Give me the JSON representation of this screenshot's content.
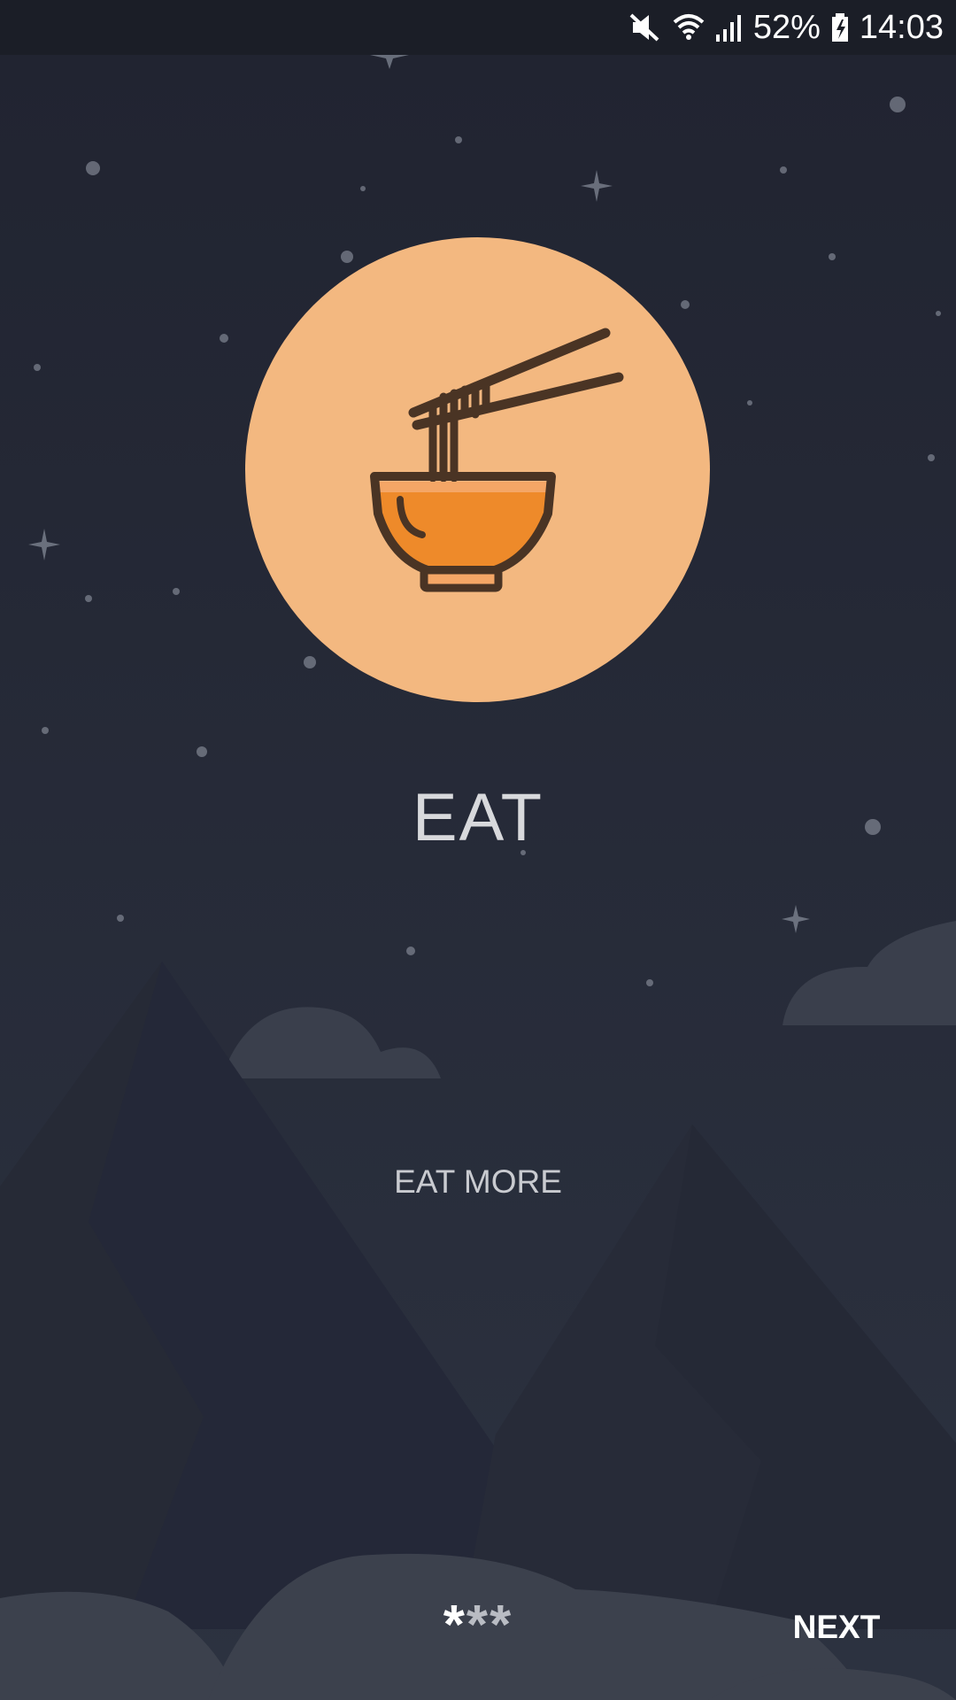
{
  "status_bar": {
    "battery_percent": "52%",
    "time": "14:03",
    "icons": [
      "mute-icon",
      "wifi-icon",
      "signal-icon",
      "battery-icon"
    ]
  },
  "onboarding": {
    "icon": "noodle-bowl-icon",
    "title": "EAT",
    "subtitle": "EAT MORE",
    "page_indicator": {
      "dots": [
        "*",
        "*",
        "*"
      ],
      "active_index": 0
    },
    "next_label": "NEXT"
  },
  "colors": {
    "background": "#222632",
    "status_bar": "#1b1e27",
    "circle": "#f3b880",
    "bowl_fill": "#ee8a2a",
    "outline": "#4a3424"
  }
}
